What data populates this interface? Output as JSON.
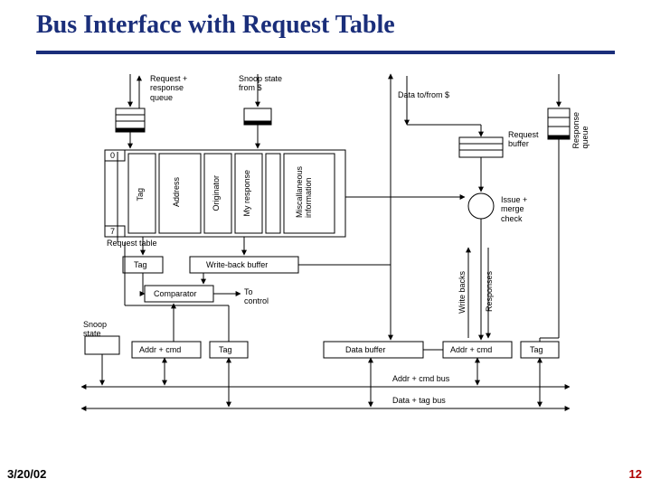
{
  "title": "Bus Interface with Request Table",
  "date": "3/20/02",
  "page_number": "12",
  "labels": {
    "req_resp_queue": "Request +\nresponse\nqueue",
    "snoop_state_from_cache": "Snoop state\nfrom $",
    "data_tofrom_cache": "Data to/from $",
    "request_buffer": "Request\nbuffer",
    "issue_merge_check": "Issue +\nmerge\ncheck",
    "response_queue": "Response\nqueue",
    "row_0": "0",
    "row_7": "7",
    "tag_col": "Tag",
    "address_col": "Address",
    "originator_col": "Originator",
    "my_response_col": "My response",
    "misc_info_col": "Miscallaneous\ninformation",
    "request_table": "Request table",
    "tag_box": "Tag",
    "writeback_buffer": "Write-back buffer",
    "comparator": "Comparator",
    "to_control": "To\ncontrol",
    "snoop_state": "Snoop\nstate",
    "addr_cmd_left": "Addr + cmd",
    "tag_left": "Tag",
    "data_buffer": "Data buffer",
    "addr_cmd_right": "Addr + cmd",
    "tag_right": "Tag",
    "write_backs": "Write backs",
    "responses": "Responses",
    "addr_cmd_bus": "Addr + cmd bus",
    "data_tag_bus": "Data + tag bus"
  }
}
